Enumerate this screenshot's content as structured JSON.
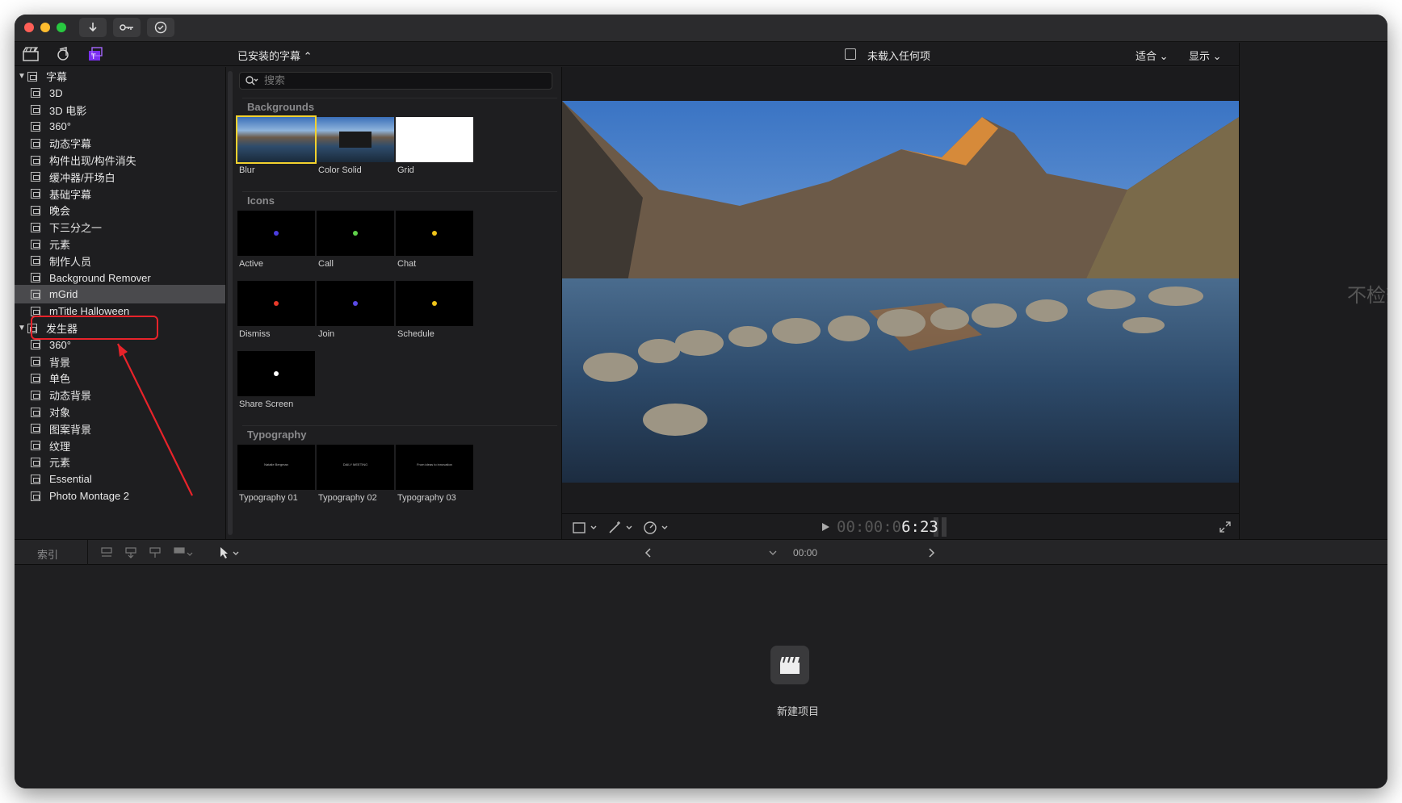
{
  "toolbar": {
    "library_title": "已安装的字幕 ⌃",
    "viewer_title": "未载入任何项",
    "fit_label": "适合 ⌄",
    "show_label": "显示 ⌄"
  },
  "sidebar": {
    "titles_group": "字幕",
    "titles_items": [
      "3D",
      "3D 电影",
      "360°",
      "动态字幕",
      "构件出现/构件消失",
      "缓冲器/开场白",
      "基础字幕",
      "晚会",
      "下三分之一",
      "元素",
      "制作人员",
      "Background Remover",
      "mGrid",
      "mTitle Halloween"
    ],
    "generators_group": "发生器",
    "generators_items": [
      "360°",
      "背景",
      "单色",
      "动态背景",
      "对象",
      "图案背景",
      "纹理",
      "元素",
      "Essential",
      "Photo Montage 2"
    ]
  },
  "browser": {
    "search_placeholder": "搜索",
    "sections": [
      {
        "title": "Backgrounds",
        "items": [
          "Blur",
          "Color Solid",
          "Grid"
        ]
      },
      {
        "title": "Icons",
        "items": [
          "Active",
          "Call",
          "Chat",
          "Dismiss",
          "Join",
          "Schedule",
          "Share Screen"
        ]
      },
      {
        "title": "Typography",
        "items": [
          "Typography 01",
          "Typography 02",
          "Typography 03"
        ]
      }
    ],
    "typo_captions": [
      "Natalie Bergman",
      "DAILY MEETING",
      "From ideas to innovation"
    ],
    "icon_dot_colors": [
      "#4b3de0",
      "#5fd14a",
      "#f0c419",
      "#e83a2a",
      "#5a4ae6",
      "#f0c419",
      "#ffffff"
    ]
  },
  "viewer": {
    "timecode_dim": "00:00:0",
    "timecode_bright": "6:23",
    "inspector_text": "不检查"
  },
  "timeline": {
    "index_label": "索引",
    "time_label": "00:00",
    "new_project_label": "新建项目"
  }
}
